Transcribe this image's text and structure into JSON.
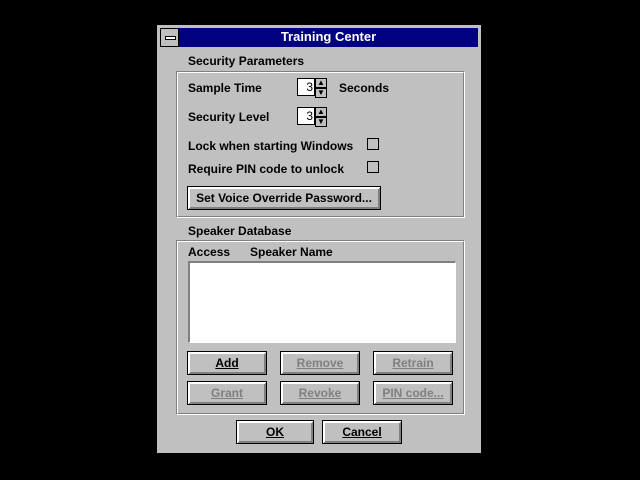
{
  "window": {
    "title": "Training Center"
  },
  "security": {
    "group_label": "Security Parameters",
    "sample_time_label": "Sample Time",
    "sample_time_value": "3",
    "seconds_label": "Seconds",
    "security_level_label": "Security Level",
    "security_level_value": "3",
    "lock_label": "Lock when starting Windows",
    "lock_checked": false,
    "pin_label": "Require PIN code to unlock",
    "pin_checked": false,
    "voice_button": "Set Voice Override Password..."
  },
  "speaker": {
    "group_label": "Speaker Database",
    "columns": [
      "Access",
      "Speaker Name"
    ],
    "rows": [],
    "buttons": {
      "add": "Add",
      "remove": "Remove",
      "retrain": "Retrain",
      "grant": "Grant",
      "revoke": "Revoke",
      "pin_code": "PIN code..."
    }
  },
  "footer": {
    "ok": "OK",
    "cancel": "Cancel"
  },
  "icons": {
    "system_menu": "system-menu-icon",
    "spin_up": "up-arrow-icon",
    "spin_down": "down-arrow-icon"
  }
}
